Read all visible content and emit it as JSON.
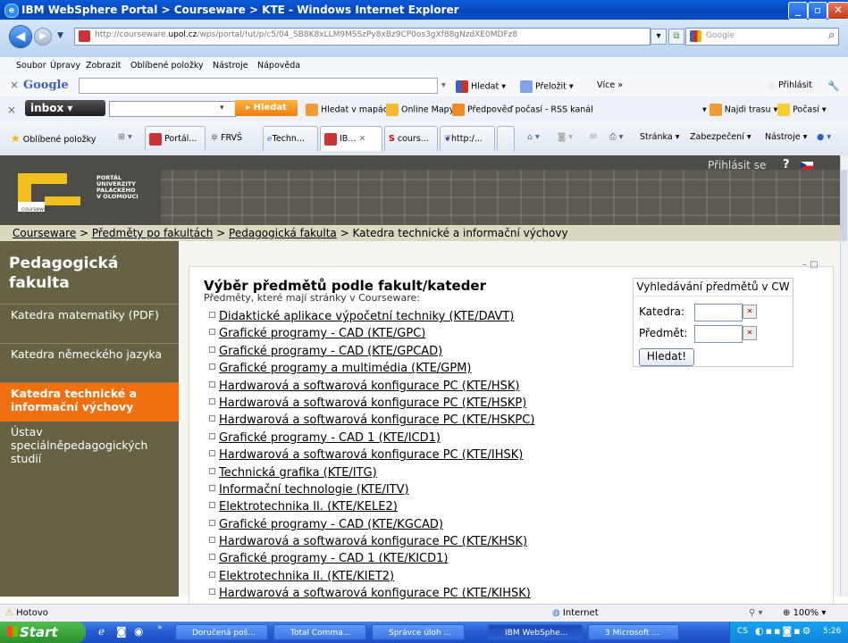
{
  "window": {
    "title": "IBM WebSphere Portal > Courseware > KTE - Windows Internet Explorer"
  },
  "addressbar": {
    "url_prefix": "http://courseware.",
    "url_domain": "upol.cz",
    "url_rest": "/wps/portal/!ut/p/c5/04_SB8K8xLLM9MSSzPy8xBz9CP0os3gXf88gNzdXE0MDFz8",
    "search_placeholder": "Google"
  },
  "menubar": {
    "items": [
      "Soubor",
      "Úpravy",
      "Zobrazit",
      "Oblíbené položky",
      "Nástroje",
      "Nápověda"
    ]
  },
  "googlebar": {
    "logo": "Google",
    "hledat": "Hledat",
    "prelozit": "Přeložit",
    "vice": "Více »",
    "prihlasit": "Přihlásit"
  },
  "inboxbar": {
    "inbox": "inbox",
    "hledat_button": "Hledat",
    "links": [
      "Hledat v mapách",
      "Online Mapy",
      "Předpověď počasí - RSS kanál"
    ],
    "najdi_trasu": "Najdi trasu",
    "pocasi": "Počasí"
  },
  "favbar": {
    "oblibene": "Oblíbené položky",
    "tabs": [
      "Portál...",
      "FRVŠ",
      "Techn...",
      "IB...",
      "cours...",
      "http:/..."
    ],
    "tools": [
      "Stránka",
      "Zabezpečení",
      "Nástroje"
    ]
  },
  "portal": {
    "login": "Přihlásit se",
    "help": "?",
    "university_lines": [
      "PORTÁL",
      "UNIVERZITY",
      "PALACKÉHO",
      "V OLOMOUCI"
    ],
    "logo_word": "courseware"
  },
  "breadcrumb": {
    "links": [
      "Courseware",
      "Předměty po fakultách",
      "Pedagogická fakulta"
    ],
    "current": "Katedra technické a informační výchovy",
    "sep": " > "
  },
  "leftnav": {
    "heading": "Pedagogická fakulta",
    "items": [
      {
        "label": "Katedra matematiky (PDF)",
        "active": false
      },
      {
        "label": "Katedra německého jazyka",
        "active": false
      },
      {
        "label": "Katedra technické a informační výchovy",
        "active": true
      },
      {
        "label": "Ústav speciálněpedagogických studií",
        "active": false
      }
    ]
  },
  "main": {
    "title": "Výběr předmětů podle fakult/kateder",
    "subtitle": "Předměty, které mají stránky v Courseware:",
    "window_controls": "– □",
    "subjects": [
      "Didaktické aplikace výpočetní techniky (KTE/DAVT)",
      "Grafické programy - CAD (KTE/GPC)",
      "Grafické programy - CAD (KTE/GPCAD)",
      "Grafické programy a multimédia (KTE/GPM)",
      "Hardwarová a softwarová konfigurace PC (KTE/HSK)",
      "Hardwarová a softwarová konfigurace PC (KTE/HSKP)",
      "Hardwarová a softwarová konfigurace PC (KTE/HSKPC)",
      "Grafické programy - CAD 1 (KTE/ICD1)",
      "Hardwarová a softwarová konfigurace PC (KTE/IHSK)",
      "Technická grafika (KTE/ITG)",
      "Informační technologie (KTE/ITV)",
      "Elektrotechnika II. (KTE/KELE2)",
      "Grafické programy - CAD (KTE/KGCAD)",
      "Hardwarová a softwarová konfigurace PC (KTE/KHSK)",
      "Grafické programy - CAD 1 (KTE/KICD1)",
      "Elektrotechnika II. (KTE/KIET2)",
      "Hardwarová a softwarová konfigurace PC (KTE/KIHSK)"
    ]
  },
  "search": {
    "title": "Vyhledávání předmětů v CW",
    "katedra_label": "Katedra:",
    "predmet_label": "Předmět:",
    "katedra_value": "",
    "predmet_value": "",
    "button": "Hledat!"
  },
  "statusbar": {
    "status": "Hotovo",
    "zone": "Internet",
    "zoom": "100%"
  },
  "taskbar": {
    "start": "Start",
    "items": [
      "Doručená poš...",
      "Total Comma...",
      "Správce úloh ...",
      "IBM WebSphe...",
      "3 Microsoft ..."
    ],
    "lang": "CS",
    "time": "5:26"
  }
}
